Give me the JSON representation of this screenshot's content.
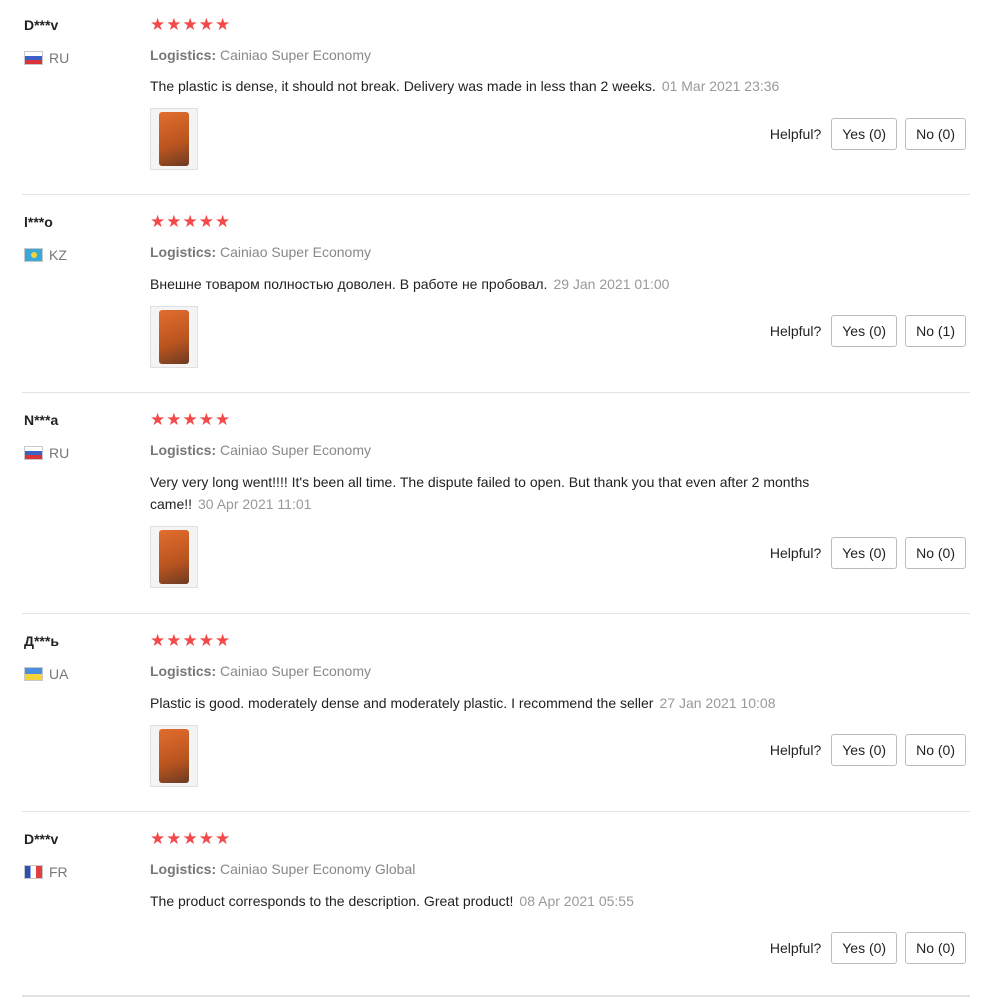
{
  "logistics_label": "Logistics:",
  "helpful_label": "Helpful?",
  "colors": {
    "star": "#f24a4a",
    "divider": "#e3e3e3",
    "muted_text": "#999999"
  },
  "reviews": [
    {
      "user": "D***v",
      "country": "RU",
      "flag_icon": "flag-ru-icon",
      "rating": 5,
      "stars": "★★★★★",
      "logistics": "Cainiao Super Economy",
      "text": "The plastic is dense, it should not break. Delivery was made in less than 2 weeks.",
      "date": "01 Mar 2021 23:36",
      "yes": "Yes (0)",
      "no": "No (0)"
    },
    {
      "user": "l***o",
      "country": "KZ",
      "flag_icon": "flag-kz-icon",
      "rating": 5,
      "stars": "★★★★★",
      "logistics": "Cainiao Super Economy",
      "text": "Внешне товаром полностью доволен. В работе не пробовал.",
      "date": "29 Jan 2021 01:00",
      "yes": "Yes (0)",
      "no": "No (1)"
    },
    {
      "user": "N***a",
      "country": "RU",
      "flag_icon": "flag-ru-icon",
      "rating": 5,
      "stars": "★★★★★",
      "logistics": "Cainiao Super Economy",
      "text": "Very very long went!!!! It's been all time. The dispute failed to open. But thank you that even after 2 months came!!",
      "date": "30 Apr 2021 11:01",
      "yes": "Yes (0)",
      "no": "No (0)"
    },
    {
      "user": "Д***ь",
      "country": "UA",
      "flag_icon": "flag-ua-icon",
      "rating": 5,
      "stars": "★★★★★",
      "logistics": "Cainiao Super Economy",
      "text": "Plastic is good. moderately dense and moderately plastic. I recommend the seller",
      "date": "27 Jan 2021 10:08",
      "yes": "Yes (0)",
      "no": "No (0)"
    },
    {
      "user": "D***v",
      "country": "FR",
      "flag_icon": "flag-fr-icon",
      "rating": 5,
      "stars": "★★★★★",
      "logistics": "Cainiao Super Economy Global",
      "text": "The product corresponds to the description. Great product!",
      "date": "08 Apr 2021 05:55",
      "yes": "Yes (0)",
      "no": "No (0)"
    }
  ]
}
